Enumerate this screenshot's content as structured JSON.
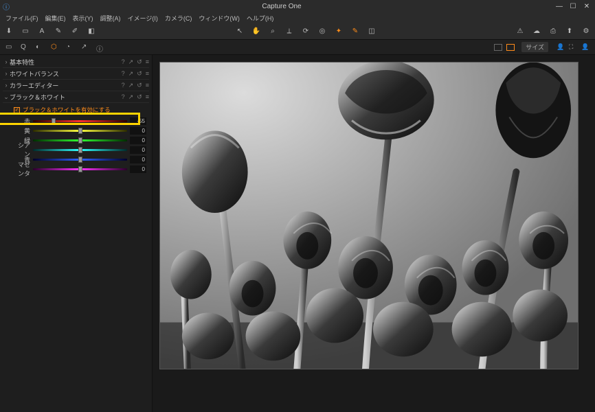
{
  "app": {
    "title": "Capture One"
  },
  "menu": [
    "ファイル(F)",
    "編集(E)",
    "表示(Y)",
    "調整(A)",
    "イメージ(I)",
    "カメラ(C)",
    "ウィンドウ(W)",
    "ヘルプ(H)"
  ],
  "subbar": {
    "size_label": "サイズ"
  },
  "panels": [
    {
      "title": "基本特性",
      "expanded": false,
      "help": true
    },
    {
      "title": "ホワイトバランス",
      "expanded": false,
      "help": true
    },
    {
      "title": "カラーエディター",
      "expanded": false,
      "help": true
    },
    {
      "title": "ブラック＆ホワイト",
      "expanded": true,
      "help": true
    }
  ],
  "bw": {
    "checkbox_label": "ブラック＆ホワイトを有効にする",
    "checked": true,
    "sliders": [
      {
        "label": "赤",
        "value": -55,
        "grad": "grad-red",
        "pos": 22
      },
      {
        "label": "黄",
        "value": 0,
        "grad": "grad-yellow",
        "pos": 50
      },
      {
        "label": "緑",
        "value": 0,
        "grad": "grad-green",
        "pos": 50
      },
      {
        "label": "シアン",
        "value": 0,
        "grad": "grad-cyan",
        "pos": 50
      },
      {
        "label": "青",
        "value": 0,
        "grad": "grad-blue",
        "pos": 50
      },
      {
        "label": "マゼンタ",
        "value": 0,
        "grad": "grad-mag",
        "pos": 50
      }
    ]
  }
}
